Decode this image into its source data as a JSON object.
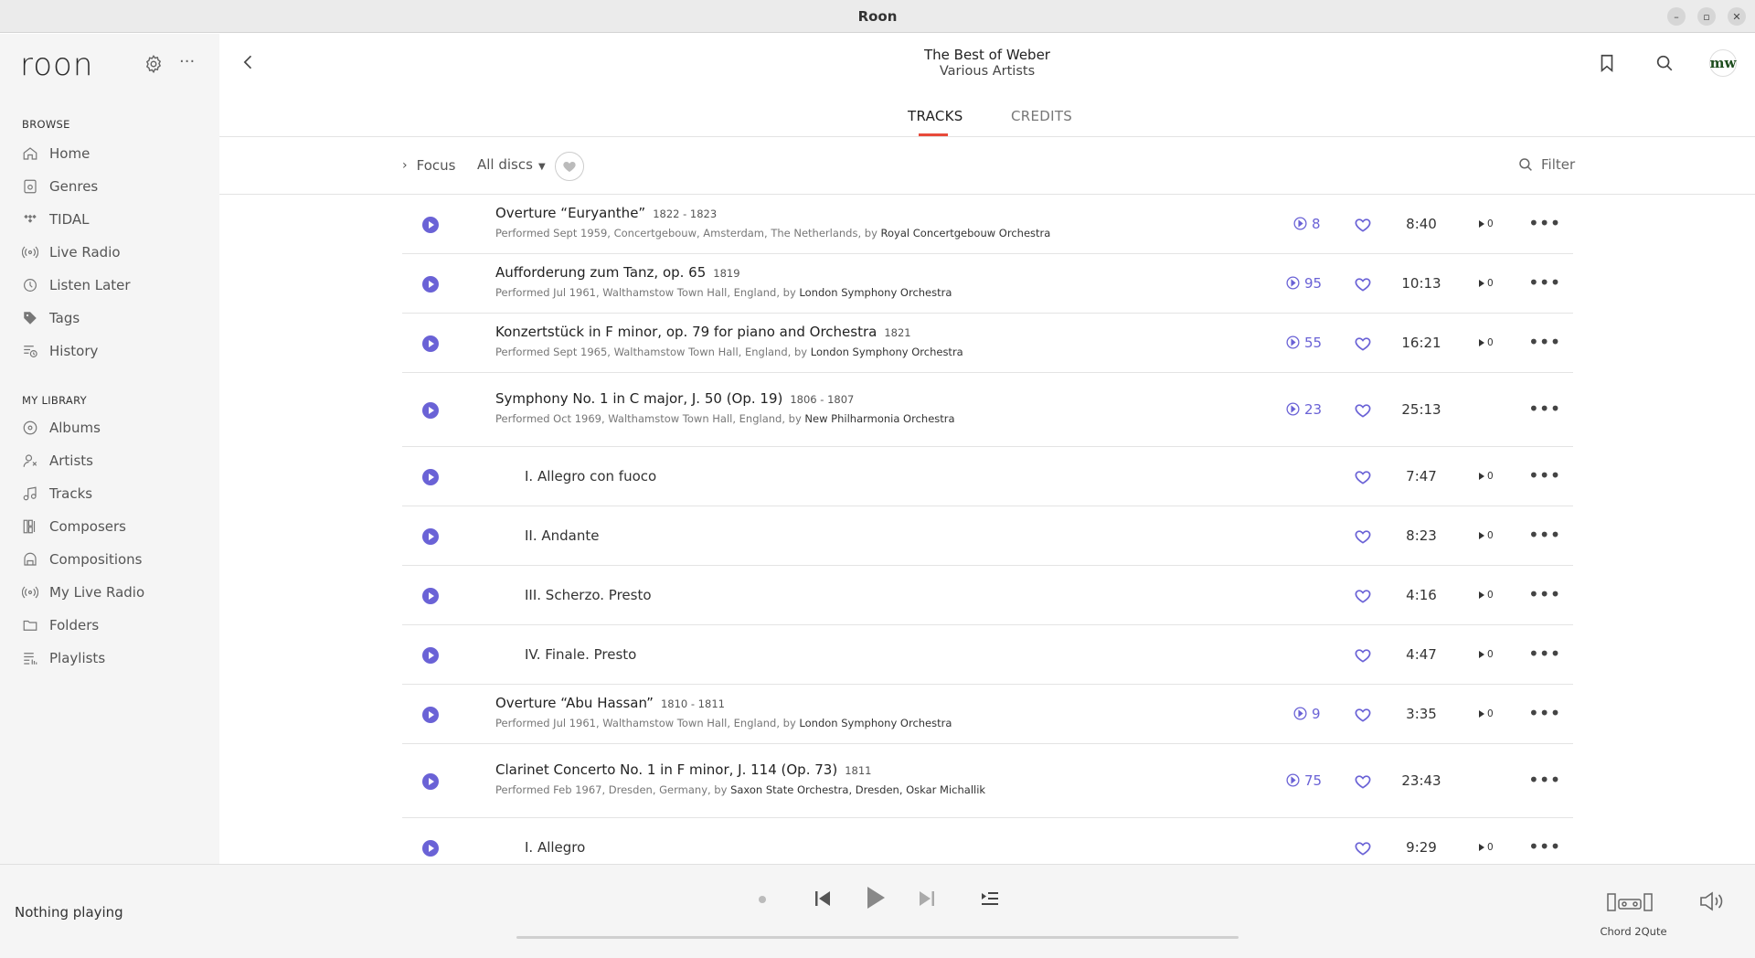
{
  "window": {
    "title": "Roon"
  },
  "sidebar": {
    "logo": "roon",
    "browse_label": "BROWSE",
    "browse_items": [
      {
        "label": "Home",
        "icon": "home-icon"
      },
      {
        "label": "Genres",
        "icon": "genres-icon"
      },
      {
        "label": "TIDAL",
        "icon": "tidal-icon"
      },
      {
        "label": "Live Radio",
        "icon": "radio-icon"
      },
      {
        "label": "Listen Later",
        "icon": "clock-icon"
      },
      {
        "label": "Tags",
        "icon": "tag-icon"
      },
      {
        "label": "History",
        "icon": "history-icon"
      }
    ],
    "library_label": "MY LIBRARY",
    "library_items": [
      {
        "label": "Albums",
        "icon": "album-icon"
      },
      {
        "label": "Artists",
        "icon": "artist-icon"
      },
      {
        "label": "Tracks",
        "icon": "music-note-icon"
      },
      {
        "label": "Composers",
        "icon": "composer-icon"
      },
      {
        "label": "Compositions",
        "icon": "composition-icon"
      },
      {
        "label": "My Live Radio",
        "icon": "radio-icon"
      },
      {
        "label": "Folders",
        "icon": "folder-icon"
      },
      {
        "label": "Playlists",
        "icon": "playlist-icon"
      }
    ]
  },
  "header": {
    "album_title": "The Best of Weber",
    "album_artist": "Various Artists",
    "avatar_initials": "mw"
  },
  "tabs": [
    {
      "label": "TRACKS",
      "active": true
    },
    {
      "label": "CREDITS",
      "active": false
    }
  ],
  "toolbar": {
    "focus_label": "Focus",
    "discs_label": "All discs",
    "filter_label": "Filter"
  },
  "tracks": [
    {
      "type": "work",
      "name": "Overture “Euryanthe”",
      "years": "1822 - 1823",
      "perf_prefix": "Performed Sept 1959, Concertgebouw, Amsterdam, The Netherlands, by",
      "performer": "Royal Concertgebouw Orchestra",
      "versions": "8",
      "duration": "8:40",
      "plays": "0"
    },
    {
      "type": "work",
      "name": "Aufforderung zum Tanz, op. 65",
      "years": "1819",
      "perf_prefix": "Performed Jul 1961, Walthamstow Town Hall, England, by",
      "performer": "London Symphony Orchestra",
      "versions": "95",
      "duration": "10:13",
      "plays": "0"
    },
    {
      "type": "work",
      "name": "Konzertstück in F minor, op. 79 for piano and Orchestra",
      "years": "1821",
      "perf_prefix": "Performed Sept 1965, Walthamstow Town Hall, England, by",
      "performer": "London Symphony Orchestra",
      "versions": "55",
      "duration": "16:21",
      "plays": "0"
    },
    {
      "type": "work",
      "name": "Symphony No. 1 in C major, J. 50 (Op. 19)",
      "years": "1806 - 1807",
      "perf_prefix": "Performed Oct 1969, Walthamstow Town Hall, England, by",
      "performer": "New Philharmonia Orchestra",
      "versions": "23",
      "duration": "25:13",
      "plays": null
    },
    {
      "type": "movement",
      "name": "I. Allegro con fuoco",
      "duration": "7:47",
      "plays": "0"
    },
    {
      "type": "movement",
      "name": "II. Andante",
      "duration": "8:23",
      "plays": "0"
    },
    {
      "type": "movement",
      "name": "III. Scherzo. Presto",
      "duration": "4:16",
      "plays": "0"
    },
    {
      "type": "movement",
      "name": "IV. Finale. Presto",
      "duration": "4:47",
      "plays": "0"
    },
    {
      "type": "work",
      "name": "Overture “Abu Hassan”",
      "years": "1810 - 1811",
      "perf_prefix": "Performed Jul 1961, Walthamstow Town Hall, England, by",
      "performer": "London Symphony Orchestra",
      "versions": "9",
      "duration": "3:35",
      "plays": "0"
    },
    {
      "type": "work",
      "name": "Clarinet Concerto No. 1 in F minor, J. 114 (Op. 73)",
      "years": "1811",
      "perf_prefix": "Performed Feb 1967, Dresden, Germany, by",
      "performer": "Saxon State Orchestra, Dresden, Oskar Michallik",
      "versions": "75",
      "duration": "23:43",
      "plays": null
    },
    {
      "type": "movement",
      "name": "I. Allegro",
      "duration": "9:29",
      "plays": "0"
    }
  ],
  "player": {
    "now_playing": "Nothing playing",
    "zone": "Chord 2Qute"
  },
  "colors": {
    "accent": "#6a62d6",
    "tab_underline": "#e84a3a"
  }
}
